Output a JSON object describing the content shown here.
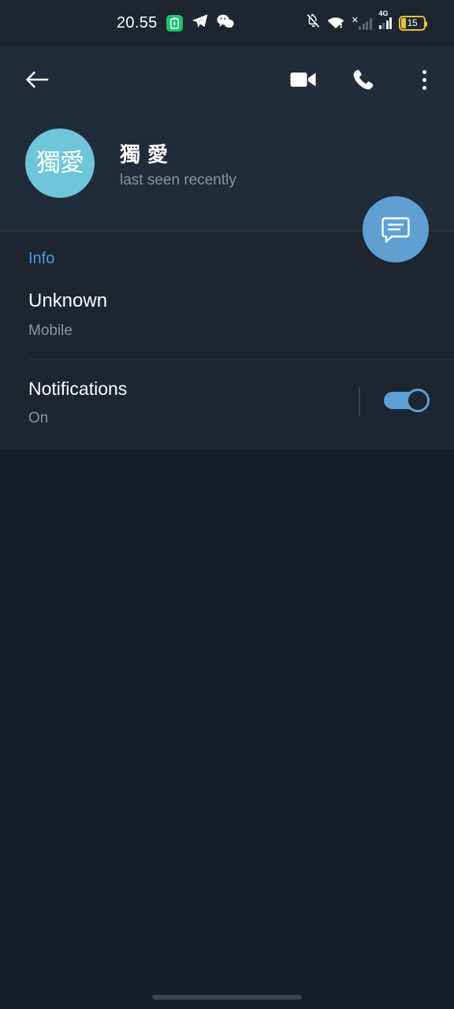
{
  "status_bar": {
    "time": "20.55",
    "battery_percent": "15",
    "network_type": "4G",
    "icons": [
      "battery-saver-icon",
      "telegram-icon",
      "wechat-icon",
      "notifications-muted-icon",
      "wifi-icon",
      "signal-no-sim-icon",
      "signal-4g-icon",
      "battery-icon"
    ]
  },
  "app_bar": {
    "back_label": "←",
    "video_call_label": "Video call",
    "voice_call_label": "Call",
    "more_label": "More options"
  },
  "profile": {
    "avatar_text": "獨愛",
    "name": "獨 愛",
    "status": "last seen recently",
    "avatar_color": "#6ec6da"
  },
  "fab": {
    "label": "Send message",
    "color": "#5e9fd4"
  },
  "info_section": {
    "title": "Info",
    "rows": [
      {
        "value": "Unknown",
        "label": "Mobile"
      }
    ],
    "title_color": "#4e9ae0"
  },
  "notifications_section": {
    "title": "Notifications",
    "state": "On",
    "toggle_on": true,
    "accent_color": "#5e9fd4"
  }
}
